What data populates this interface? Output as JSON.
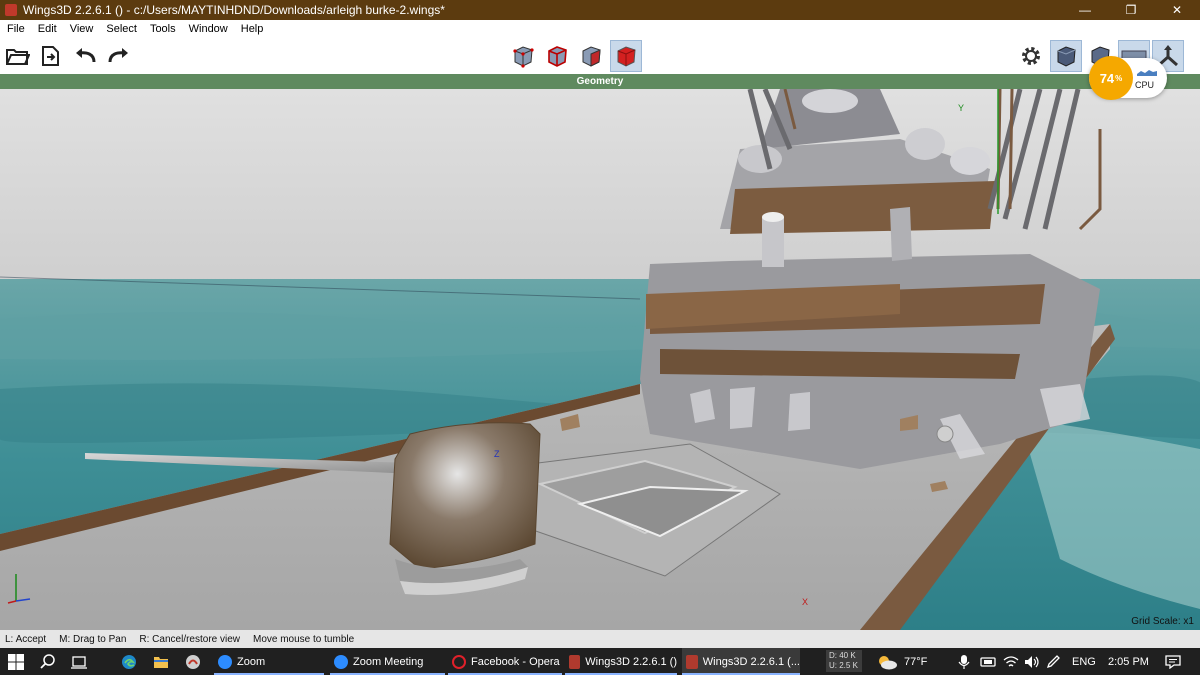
{
  "titlebar": {
    "title": "Wings3D 2.2.6.1 () - c:/Users/MAYTINHDND/Downloads/arleigh burke-2.wings*",
    "minimize": "—",
    "maximize": "❐",
    "close": "✕"
  },
  "menu": {
    "items": [
      "File",
      "Edit",
      "View",
      "Select",
      "Tools",
      "Window",
      "Help"
    ]
  },
  "toolbar": {
    "left_icons": [
      "open-folder-icon",
      "save-icon",
      "undo-icon",
      "redo-icon"
    ],
    "selection_modes": [
      "vertex-mode-icon",
      "edge-mode-icon",
      "face-mode-icon",
      "body-mode-icon"
    ],
    "right_icons": [
      "settings-gear-icon",
      "smooth-view-icon",
      "wireframe-view-icon",
      "ground-plane-icon",
      "axes-icon"
    ]
  },
  "geometry_header": "Geometry",
  "cpu": {
    "value": "74",
    "unit": "%",
    "label": "CPU"
  },
  "viewport": {
    "axis_labels": {
      "y": "Y",
      "z": "Z",
      "x": "X"
    },
    "grid_scale": "Grid Scale: x1"
  },
  "statusbar": {
    "items": [
      "L: Accept",
      "M: Drag to Pan",
      "R: Cancel/restore view",
      "Move mouse to tumble"
    ]
  },
  "taskbar": {
    "apps": [
      {
        "label": "Zoom"
      },
      {
        "label": "Zoom Meeting"
      },
      {
        "label": "Facebook - Opera"
      },
      {
        "label": "Wings3D 2.2.6.1 ()"
      },
      {
        "label": "Wings3D 2.2.6.1 (..."
      }
    ],
    "net": {
      "down": "D: 40 K",
      "up": "U: 2.5 K"
    },
    "weather": "77°F",
    "language": "ENG",
    "time": "2:05 PM"
  },
  "colors": {
    "titlebar": "#5c3b0f",
    "geometry_header": "#5f8a5f",
    "cpu_badge": "#f5a800",
    "taskbar": "#202020"
  }
}
